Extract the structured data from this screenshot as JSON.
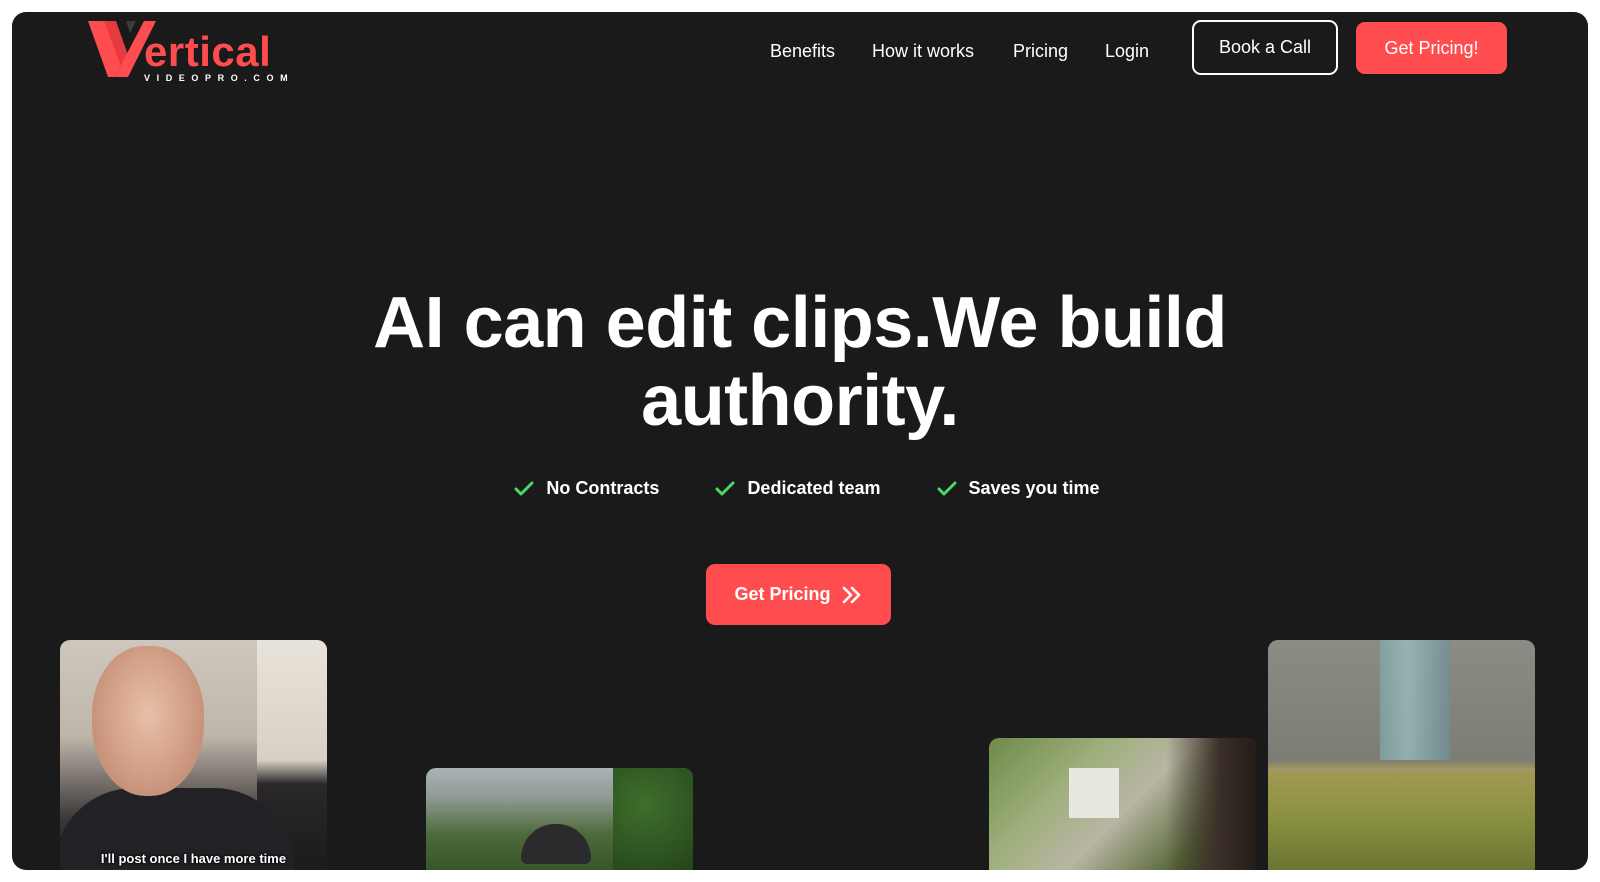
{
  "header": {
    "logo": {
      "word": "ertical",
      "sub": "VIDEOPRO.COM"
    },
    "nav": [
      {
        "label": "Benefits"
      },
      {
        "label": "How it works"
      },
      {
        "label": "Pricing"
      },
      {
        "label": "Login"
      }
    ],
    "book_call_label": "Book a Call",
    "get_pricing_label": "Get Pricing!"
  },
  "hero": {
    "headline_line1": "AI can edit clips.We build",
    "headline_line2": "authority.",
    "features": [
      {
        "label": "No Contracts",
        "icon": "check-icon"
      },
      {
        "label": "Dedicated team",
        "icon": "check-icon"
      },
      {
        "label": "Saves you time",
        "icon": "check-icon"
      }
    ],
    "cta_label": "Get Pricing",
    "cta_icon": "double-chevron-right-icon"
  },
  "thumbnails": {
    "first_caption": "I'll post once I have more time"
  },
  "colors": {
    "background": "#1a1a1a",
    "accent": "#ff4d4f",
    "check": "#4cd964",
    "text": "#ffffff"
  }
}
